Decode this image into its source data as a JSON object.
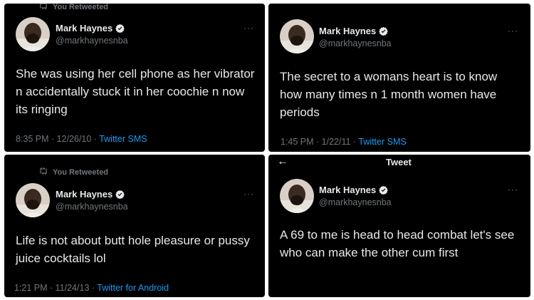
{
  "panels": [
    {
      "retweet_label": "You Retweeted",
      "name": "Mark Haynes",
      "handle": "@markhaynesnba",
      "more": "···",
      "text": "She was using her cell phone as her vibrator n accidentally stuck it in her coochie n now its ringing",
      "time_date": "8:35 PM · 12/26/10 · ",
      "source": "Twitter SMS"
    },
    {
      "name": "Mark Haynes",
      "handle": "@markhaynesnba",
      "more": "···",
      "text": "The secret to a womans heart is to know how many times n 1 month women have periods",
      "time_date": "1:45 PM · 1/22/11 · ",
      "source": "Twitter SMS"
    },
    {
      "retweet_label": "You Retweeted",
      "name": "Mark Haynes",
      "handle": "@markhaynesnba",
      "more": "···",
      "text": "Life is not about butt hole pleasure or pussy juice cocktails lol",
      "time_date": "1:21 PM · 11/24/13 · ",
      "source": "Twitter for Android"
    },
    {
      "header_title": "Tweet",
      "back_arrow": "←",
      "name": "Mark Haynes",
      "handle": "@markhaynesnba",
      "more": "···",
      "text": "A 69 to me is head to head combat let's see who can make the other cum first",
      "time_date": "",
      "source": ""
    }
  ],
  "colors": {
    "background": "#000000",
    "text": "#e7e9ea",
    "muted": "#71767b",
    "link": "#1d9bf0",
    "verified": "#e7e9ea"
  },
  "icons": [
    "retweet-icon",
    "verified-badge-icon",
    "more-options-icon",
    "back-arrow-icon",
    "avatar"
  ]
}
